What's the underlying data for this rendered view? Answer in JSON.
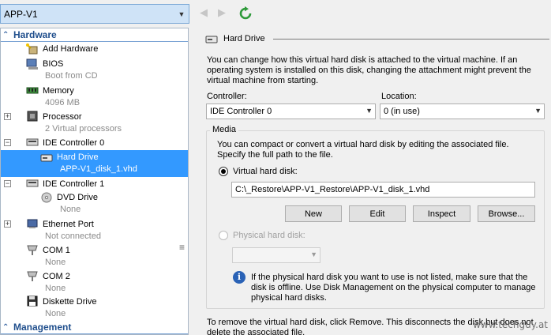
{
  "toolbar": {
    "vm_name": "APP-V1"
  },
  "hardware_section": {
    "title": "Hardware"
  },
  "management_section": {
    "title": "Management"
  },
  "items": [
    {
      "name": "Add Hardware",
      "sub": ""
    },
    {
      "name": "BIOS",
      "sub": "Boot from CD"
    },
    {
      "name": "Memory",
      "sub": "4096 MB"
    },
    {
      "name": "Processor",
      "sub": "2 Virtual processors"
    },
    {
      "name": "IDE Controller 0",
      "sub": ""
    },
    {
      "name": "Hard Drive",
      "sub": "APP-V1_disk_1.vhd"
    },
    {
      "name": "IDE Controller 1",
      "sub": ""
    },
    {
      "name": "DVD Drive",
      "sub": "None"
    },
    {
      "name": "Ethernet Port",
      "sub": "Not connected"
    },
    {
      "name": "COM 1",
      "sub": "None"
    },
    {
      "name": "COM 2",
      "sub": "None"
    },
    {
      "name": "Diskette Drive",
      "sub": "None"
    }
  ],
  "detail": {
    "title": "Hard Drive",
    "intro_1": "You can change how this virtual hard disk is attached to the virtual machine. If an",
    "intro_2": "operating system is installed on this disk, changing the attachment might prevent the",
    "intro_3": "virtual machine from starting.",
    "controller_label": "Controller:",
    "controller_value": "IDE Controller 0",
    "location_label": "Location:",
    "location_value": "0 (in use)",
    "media_label": "Media",
    "media_desc_1": "You can compact or convert a virtual hard disk by editing the associated file.",
    "media_desc_2": "Specify the full path to the file.",
    "virtual_disk_label": "Virtual hard disk:",
    "virtual_disk_path": "C:\\_Restore\\APP-V1_Restore\\APP-V1_disk_1.vhd",
    "buttons": {
      "new": "New",
      "edit": "Edit",
      "inspect": "Inspect",
      "browse": "Browse..."
    },
    "physical_disk_label": "Physical hard disk:",
    "physical_disk_value": "",
    "info_1": "If the physical hard disk you want to use is not listed, make sure that the",
    "info_2": "disk is offline. Use Disk Management on the physical computer to manage",
    "info_3": "physical hard disks.",
    "remove_1": "To remove the virtual hard disk, click Remove. This disconnects the disk but does not",
    "remove_2": "delete the associated file."
  },
  "watermark": "www.techguy.at",
  "colors": {
    "selection": "#3399ff",
    "section_header": "#1f4e8c",
    "vm_select_bg": "#cfe3f7"
  }
}
